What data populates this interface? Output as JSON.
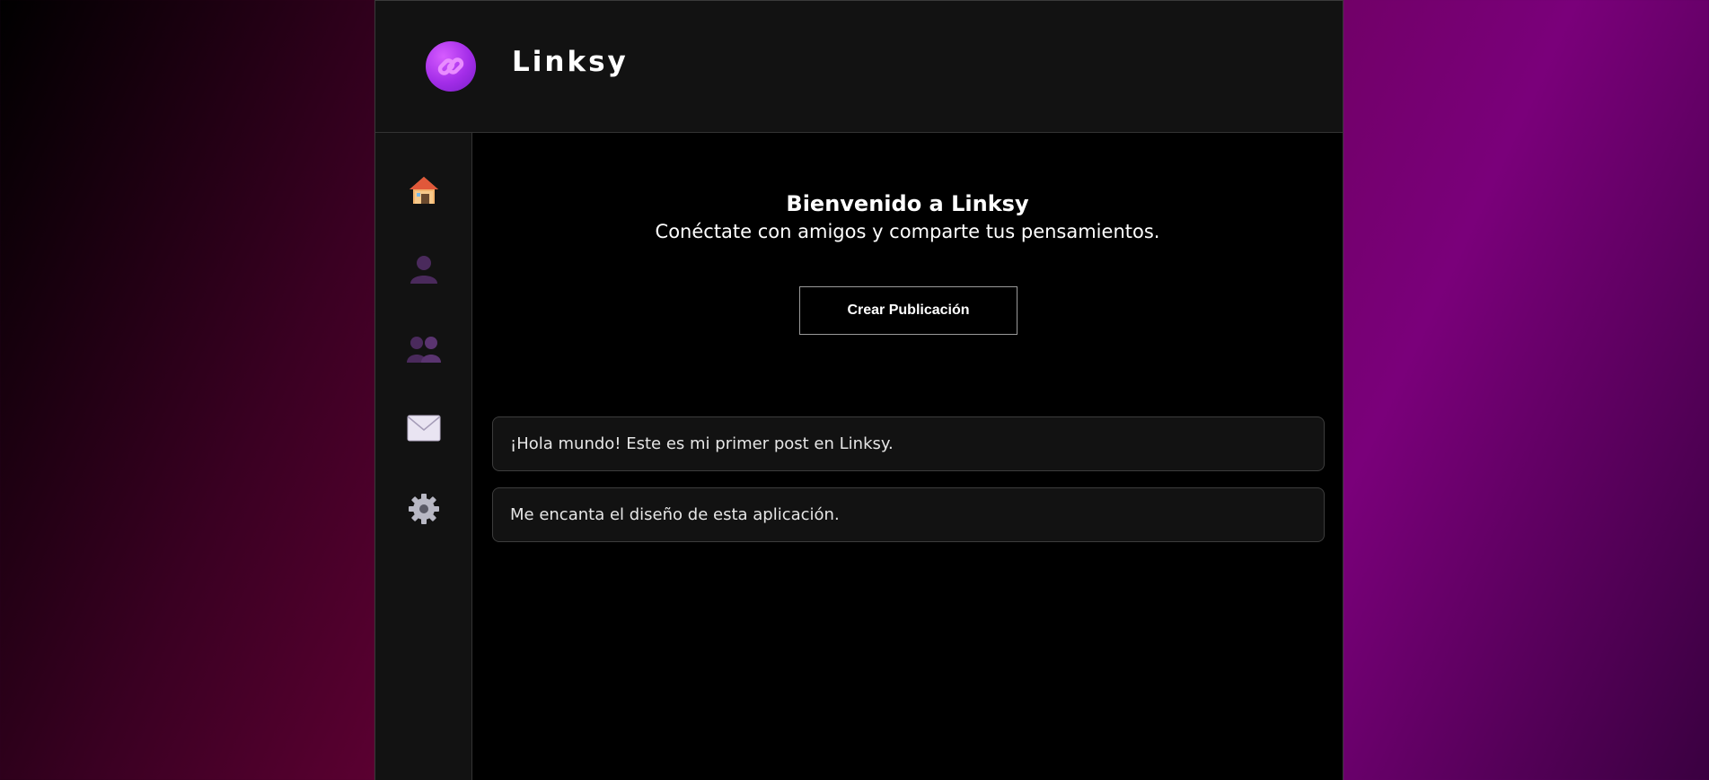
{
  "header": {
    "brand_name": "Linksy",
    "logo_icon": "link-icon",
    "logo_color": "#b63cf0"
  },
  "sidebar": {
    "items": [
      {
        "name": "home",
        "icon": "house-icon"
      },
      {
        "name": "profile",
        "icon": "user-icon"
      },
      {
        "name": "friends",
        "icon": "users-icon"
      },
      {
        "name": "messages",
        "icon": "envelope-icon"
      },
      {
        "name": "settings",
        "icon": "gear-icon"
      }
    ]
  },
  "main": {
    "welcome_title": "Bienvenido a Linksy",
    "welcome_subtitle": "Conéctate con amigos y comparte tus pensamientos.",
    "create_post_label": "Crear Publicación",
    "posts": [
      {
        "text": "¡Hola mundo! Este es mi primer post en Linksy."
      },
      {
        "text": "Me encanta el diseño de esta aplicación."
      }
    ]
  },
  "colors": {
    "panel": "#121212",
    "background": "#000000",
    "accent": "#b63cf0"
  }
}
